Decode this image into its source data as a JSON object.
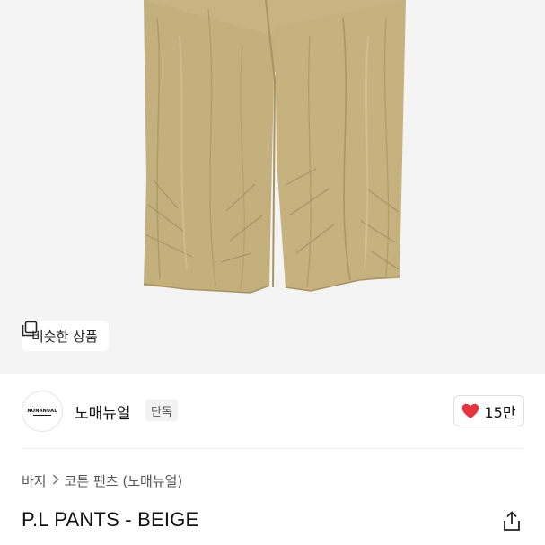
{
  "product_image": {
    "colors": {
      "background": "#f4f4f4",
      "pants": "#c5b27f",
      "shadow": "#ab9764",
      "highlight": "#d4c393"
    }
  },
  "similar_products_button": {
    "label": "비슷한 상품",
    "icon": "similar-products-icon"
  },
  "brand": {
    "logo_text": "NONANUAL",
    "name": "노매뉴얼",
    "badge": "단독"
  },
  "like": {
    "count": "15만",
    "icon": "heart-icon",
    "color": "#e8323c"
  },
  "breadcrumb": {
    "items": [
      "바지",
      "코튼 팬츠 (노매뉴얼)"
    ],
    "separator_icon": "chevron-right-icon"
  },
  "product": {
    "title": "P.L PANTS - BEIGE"
  },
  "share": {
    "icon": "share-icon"
  }
}
